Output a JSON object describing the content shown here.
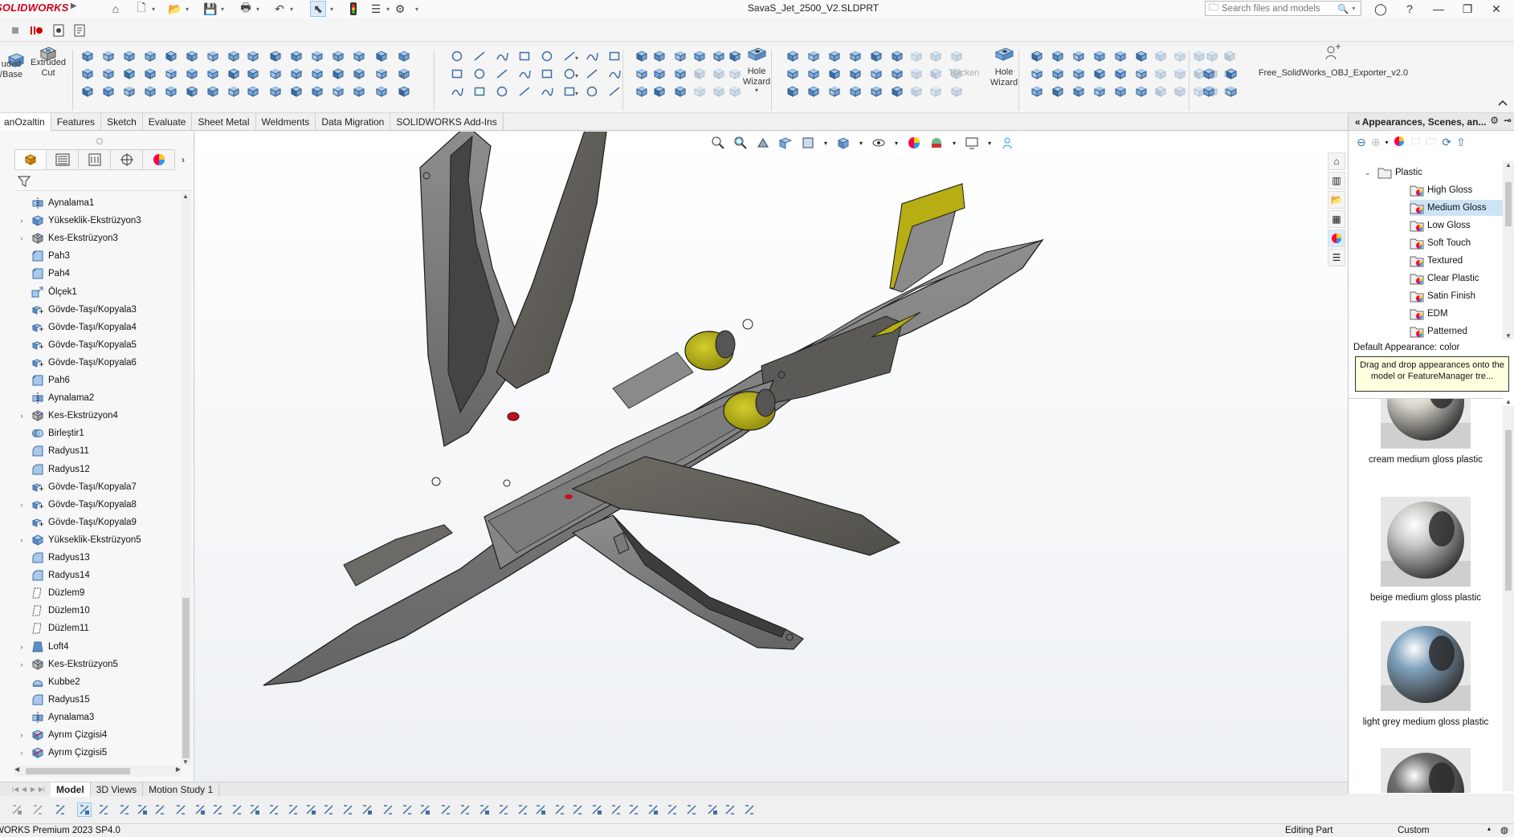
{
  "app": {
    "logo": "SOLIDWORKS",
    "document_title": "SavaS_Jet_2500_V2.SLDPRT",
    "search_placeholder": "Search files and models"
  },
  "ribbon": {
    "extruded_base": "uded\n/Base",
    "extruded_cut": "Extruded\nCut",
    "hole_wizard_1": "Hole\nWizard",
    "thicken": "Thicken",
    "hole_wizard_2": "Hole\nWizard",
    "addin": "Free_SolidWorks_OBJ_Exporter_v2.0"
  },
  "tabs": [
    {
      "label": "anOzaltin",
      "active": true
    },
    {
      "label": "Features",
      "active": false
    },
    {
      "label": "Sketch",
      "active": false
    },
    {
      "label": "Evaluate",
      "active": false
    },
    {
      "label": "Sheet Metal",
      "active": false
    },
    {
      "label": "Weldments",
      "active": false
    },
    {
      "label": "Data Migration",
      "active": false
    },
    {
      "label": "SOLIDWORKS Add-Ins",
      "active": false
    }
  ],
  "feature_tree": [
    {
      "label": "Aynalama1",
      "icon": "mirror-icon",
      "expand": false
    },
    {
      "label": "Yükseklik-Ekstrüzyon3",
      "icon": "boss-extrude-icon",
      "expand": true
    },
    {
      "label": "Kes-Ekstrüzyon3",
      "icon": "cut-extrude-icon",
      "expand": true
    },
    {
      "label": "Pah3",
      "icon": "chamfer-icon",
      "expand": false
    },
    {
      "label": "Pah4",
      "icon": "chamfer-icon",
      "expand": false
    },
    {
      "label": "Ölçek1",
      "icon": "scale-icon",
      "expand": false
    },
    {
      "label": "Gövde-Taşı/Kopyala3",
      "icon": "move-copy-icon",
      "expand": false
    },
    {
      "label": "Gövde-Taşı/Kopyala4",
      "icon": "move-copy-icon",
      "expand": false
    },
    {
      "label": "Gövde-Taşı/Kopyala5",
      "icon": "move-copy-icon",
      "expand": false
    },
    {
      "label": "Gövde-Taşı/Kopyala6",
      "icon": "move-copy-icon",
      "expand": false
    },
    {
      "label": "Pah6",
      "icon": "chamfer-icon",
      "expand": false
    },
    {
      "label": "Aynalama2",
      "icon": "mirror-icon",
      "expand": false
    },
    {
      "label": "Kes-Ekstrüzyon4",
      "icon": "cut-extrude-icon",
      "expand": true
    },
    {
      "label": "Birleştir1",
      "icon": "combine-icon",
      "expand": false
    },
    {
      "label": "Radyus11",
      "icon": "fillet-icon",
      "expand": false
    },
    {
      "label": "Radyus12",
      "icon": "fillet-icon",
      "expand": false
    },
    {
      "label": "Gövde-Taşı/Kopyala7",
      "icon": "move-copy-icon",
      "expand": false
    },
    {
      "label": "Gövde-Taşı/Kopyala8",
      "icon": "move-copy-icon",
      "expand": true
    },
    {
      "label": "Gövde-Taşı/Kopyala9",
      "icon": "move-copy-icon",
      "expand": false
    },
    {
      "label": "Yükseklik-Ekstrüzyon5",
      "icon": "boss-extrude-icon",
      "expand": true
    },
    {
      "label": "Radyus13",
      "icon": "fillet-icon",
      "expand": false
    },
    {
      "label": "Radyus14",
      "icon": "fillet-icon",
      "expand": false
    },
    {
      "label": "Düzlem9",
      "icon": "plane-icon",
      "expand": false
    },
    {
      "label": "Düzlem10",
      "icon": "plane-icon",
      "expand": false
    },
    {
      "label": "Düzlem11",
      "icon": "plane-icon",
      "expand": false
    },
    {
      "label": "Loft4",
      "icon": "loft-icon",
      "expand": true
    },
    {
      "label": "Kes-Ekstrüzyon5",
      "icon": "cut-extrude-icon",
      "expand": true
    },
    {
      "label": "Kubbe2",
      "icon": "dome-icon",
      "expand": false
    },
    {
      "label": "Radyus15",
      "icon": "fillet-icon",
      "expand": false
    },
    {
      "label": "Aynalama3",
      "icon": "mirror-icon",
      "expand": false
    },
    {
      "label": "Ayrım Çizgisi4",
      "icon": "split-line-icon",
      "expand": true
    },
    {
      "label": "Ayrım Çizgisi5",
      "icon": "split-line-icon",
      "expand": true
    }
  ],
  "task_pane": {
    "title": "Appearances, Scenes, an...",
    "tree": [
      {
        "label": "Plastic",
        "level": 0,
        "expanded": true,
        "selected": false
      },
      {
        "label": "High Gloss",
        "level": 1,
        "selected": false
      },
      {
        "label": "Medium Gloss",
        "level": 1,
        "selected": true
      },
      {
        "label": "Low Gloss",
        "level": 1,
        "selected": false
      },
      {
        "label": "Soft Touch",
        "level": 1,
        "selected": false
      },
      {
        "label": "Textured",
        "level": 1,
        "selected": false
      },
      {
        "label": "Clear Plastic",
        "level": 1,
        "selected": false
      },
      {
        "label": "Satin Finish",
        "level": 1,
        "selected": false
      },
      {
        "label": "EDM",
        "level": 1,
        "selected": false
      },
      {
        "label": "Patterned",
        "level": 1,
        "selected": false
      }
    ],
    "default_appearance": "Default Appearance: color",
    "tooltip": "Drag and drop appearances onto the model or FeatureManager tre...",
    "swatches": [
      {
        "label": "cream medium gloss plastic",
        "color": "#d9d5cc"
      },
      {
        "label": "beige medium gloss plastic",
        "color": "#c9c9c6"
      },
      {
        "label": "light grey medium gloss plastic",
        "color": "#7fa2bd"
      },
      {
        "label": "",
        "color": "#6e6e6e"
      }
    ]
  },
  "bottom_tabs": [
    {
      "label": "Model",
      "active": true
    },
    {
      "label": "3D Views",
      "active": false
    },
    {
      "label": "Motion Study 1",
      "active": false
    }
  ],
  "status": {
    "product": "WORKS Premium 2023 SP4.0",
    "mode": "Editing Part",
    "units": "Custom"
  },
  "colors": {
    "body": "#7b7b7b",
    "body_dark": "#4f4d49",
    "accent_yellow": "#b3ad13",
    "selection": "#cde4f7",
    "logo_red": "#d0021b"
  }
}
